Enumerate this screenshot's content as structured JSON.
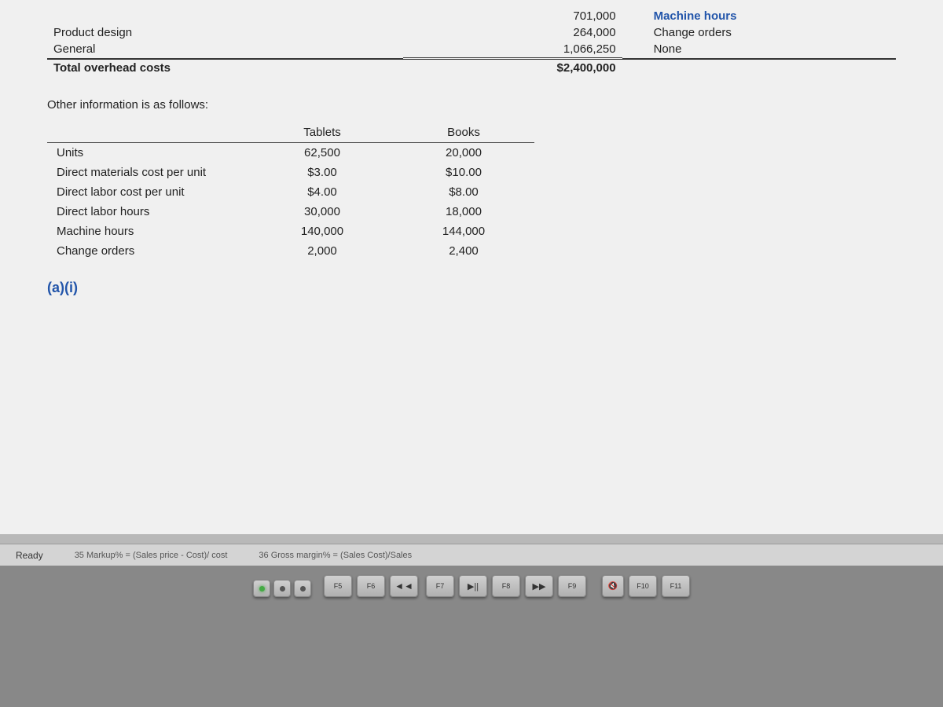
{
  "document": {
    "top_section": {
      "rows": [
        {
          "label": "Product design",
          "amount": "264,000",
          "cost_driver": "Change orders"
        },
        {
          "label": "General",
          "amount": "1,066,250",
          "cost_driver": "None"
        },
        {
          "label": "Total overhead costs",
          "amount": "$2,400,000",
          "cost_driver": ""
        }
      ],
      "partial_first_amount": "701,000",
      "partial_first_driver": "Machine hours"
    },
    "other_info_label": "Other information is as follows:",
    "table": {
      "col_headers": [
        "",
        "Tablets",
        "Books"
      ],
      "rows": [
        {
          "label": "Units",
          "tablets": "62,500",
          "books": "20,000"
        },
        {
          "label": "Direct materials cost per unit",
          "tablets": "$3.00",
          "books": "$10.00"
        },
        {
          "label": "Direct labor cost per unit",
          "tablets": "$4.00",
          "books": "$8.00"
        },
        {
          "label": "Direct labor hours",
          "tablets": "30,000",
          "books": "18,000"
        },
        {
          "label": "Machine hours",
          "tablets": "140,000",
          "books": "144,000"
        },
        {
          "label": "Change orders",
          "tablets": "2,000",
          "books": "2,400"
        }
      ]
    },
    "section_label": "(a)(i)"
  },
  "status_bar": {
    "ready": "Ready",
    "formula1": "35  Markup% = (Sales price - Cost)/ cost",
    "formula2": "36  Gross margin% = (Sales Cost)/Sales"
  },
  "keyboard": {
    "keys": [
      "F5",
      "F6",
      "F7",
      "F8",
      "F9",
      "F10",
      "F11"
    ]
  }
}
